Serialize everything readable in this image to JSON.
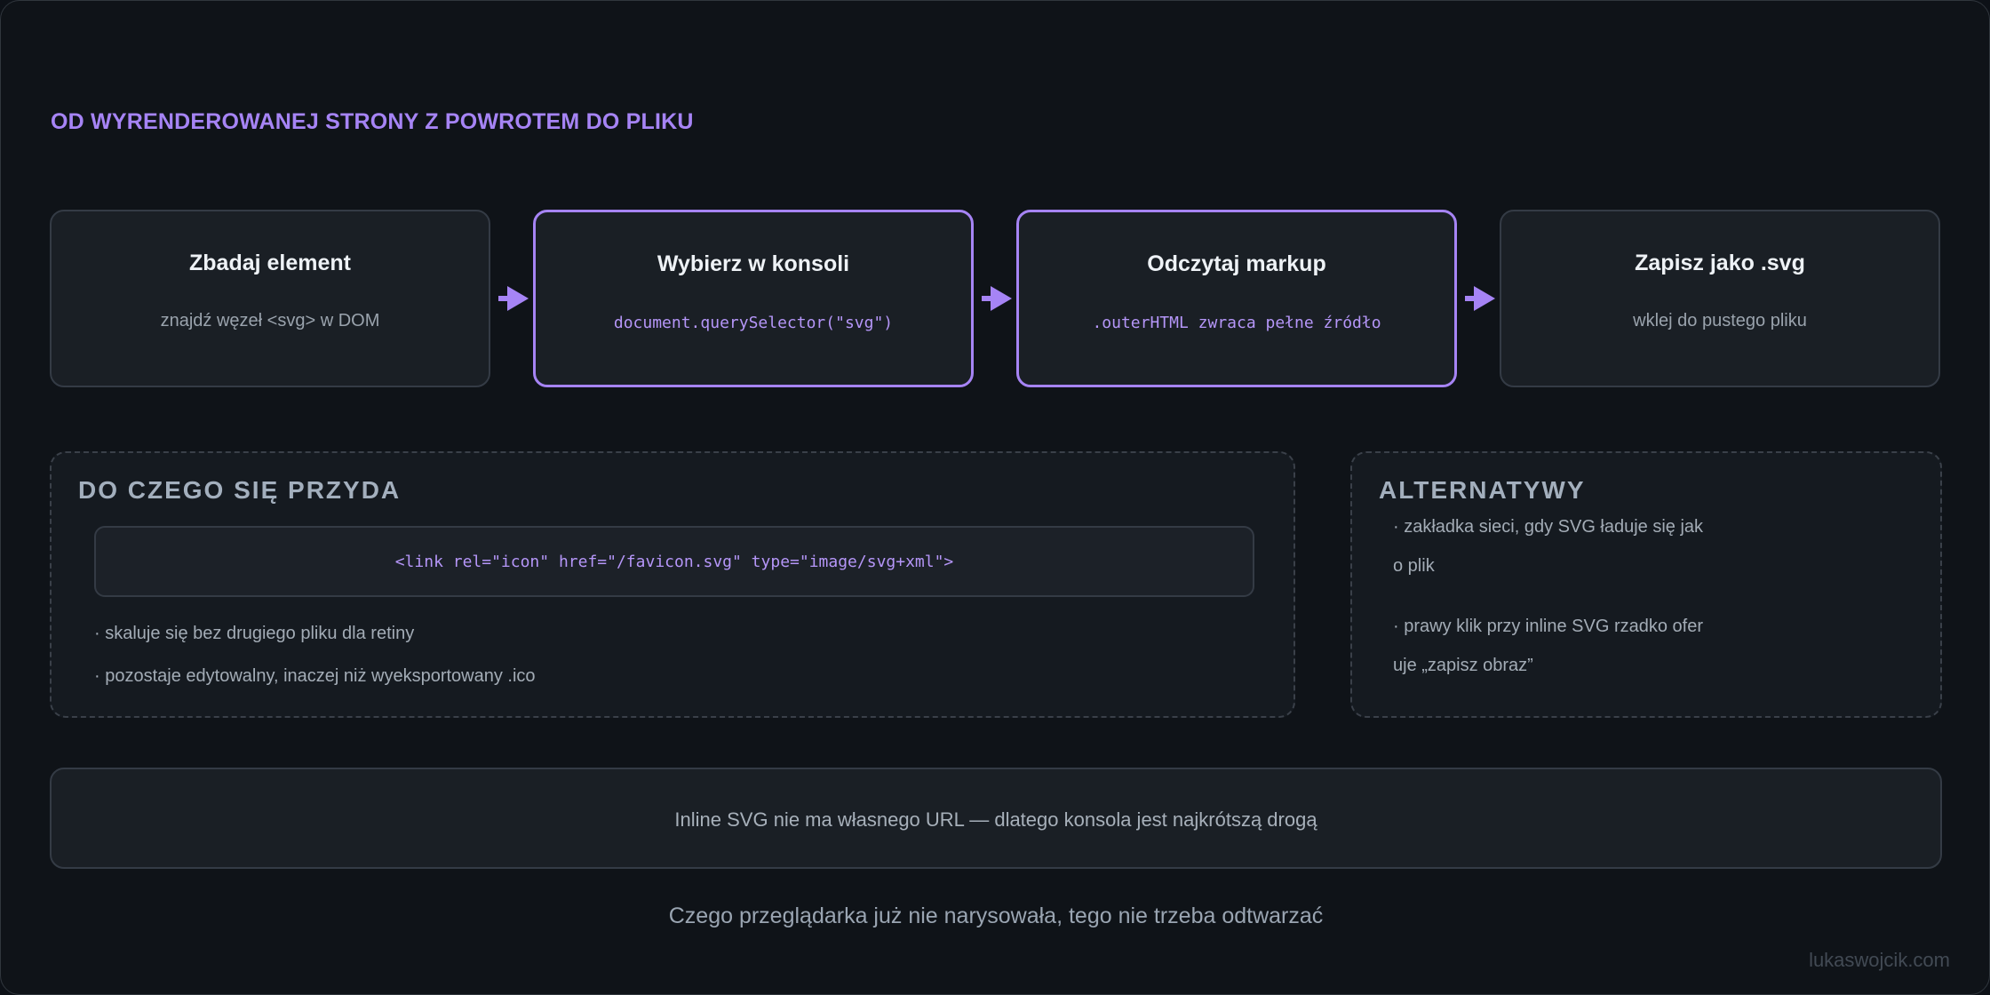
{
  "title": "OD WYRENDEROWANEJ STRONY Z POWROTEM DO PLIKU",
  "steps": [
    {
      "title": "Zbadaj element",
      "subtitle": "znajdź węzeł <svg> w DOM"
    },
    {
      "title": "Wybierz w konsoli",
      "subtitle": "document.querySelector(\"svg\")"
    },
    {
      "title": "Odczytaj markup",
      "subtitle": ".outerHTML zwraca pełne źródło"
    },
    {
      "title": "Zapisz jako .svg",
      "subtitle": "wklej do pustego pliku"
    }
  ],
  "uses": {
    "title": "DO CZEGO SIĘ PRZYDA",
    "code": "<link rel=\"icon\" href=\"/favicon.svg\" type=\"image/svg+xml\">",
    "bullets": [
      "· skaluje się bez drugiego pliku dla retiny",
      "· pozostaje edytowalny, inaczej niż wyeksportowany .ico"
    ]
  },
  "alternatives": {
    "title": "ALTERNATYWY",
    "lines": [
      "· zakładka sieci, gdy SVG ładuje się jak",
      "o plik",
      "· prawy klik przy inline SVG rzadko ofer",
      "uje „zapisz obraz”"
    ]
  },
  "note": "Inline SVG nie ma własnego URL — dlatego konsola jest najkrótszą drogą",
  "caption": "Czego przeglądarka już nie narysowała, tego nie trzeba odtwarzać",
  "signature": "lukaswojcik.com",
  "colors": {
    "accent": "#a684f5",
    "background": "#0f1318",
    "box": "#1a1f25",
    "border": "#343b45"
  }
}
